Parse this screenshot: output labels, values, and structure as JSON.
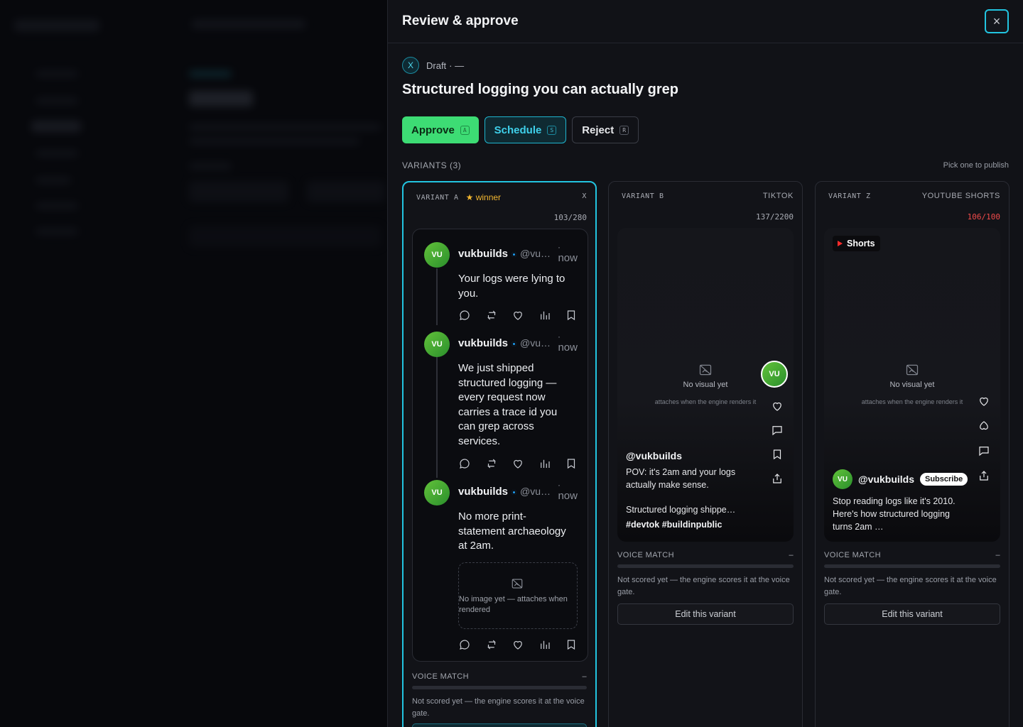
{
  "drawer": {
    "title": "Review & approve",
    "close_label": "×"
  },
  "post": {
    "platform_badge": "X",
    "status": "Draft",
    "status_suffix": "· —",
    "title": "Structured logging you can actually grep"
  },
  "actions": {
    "approve": {
      "label": "Approve",
      "key": "A"
    },
    "schedule": {
      "label": "Schedule",
      "key": "S"
    },
    "reject": {
      "label": "Reject",
      "key": "R"
    }
  },
  "variants_section": {
    "label": "VARIANTS (3)",
    "hint": "Pick one to publish"
  },
  "variants": [
    {
      "label": "VARIANT A",
      "winner_label": "winner",
      "platform": "X",
      "counter": "103/280",
      "thread": [
        {
          "avatar": "VU",
          "name": "vukbuilds",
          "handle": "@vu…",
          "dot": "·",
          "time": "now",
          "text": "Your logs were lying to you."
        },
        {
          "avatar": "VU",
          "name": "vukbuilds",
          "handle": "@vu…",
          "dot": "·",
          "time": "now",
          "text": "We just shipped structured logging — every request now carries a trace id you can grep across services."
        },
        {
          "avatar": "VU",
          "name": "vukbuilds",
          "handle": "@vu…",
          "dot": "·",
          "time": "now",
          "text": "No more print-statement archaeology at 2am.",
          "image_placeholder": "No image yet — attaches when rendered"
        }
      ],
      "voice_label": "VOICE MATCH",
      "voice_value": "–",
      "voice_score": 0,
      "voice_note": "Not scored yet — the engine scores it at the voice gate."
    },
    {
      "label": "VARIANT B",
      "platform": "TIKTOK",
      "counter": "137/2200",
      "no_visual_title": "No visual yet",
      "no_visual_sub": "attaches when the engine renders it",
      "avatar": "VU",
      "handle": "@vukbuilds",
      "caption": "POV: it's 2am and your logs actually make sense.",
      "caption2": "Structured logging shippe…",
      "tags": "#devtok #buildinpublic",
      "voice_label": "VOICE MATCH",
      "voice_value": "–",
      "voice_score": 0,
      "voice_note": "Not scored yet — the engine scores it at the voice gate.",
      "edit_label": "Edit this variant"
    },
    {
      "label": "VARIANT Z",
      "platform": "YOUTUBE SHORTS",
      "counter": "106/100",
      "shorts_label": "Shorts",
      "no_visual_title": "No visual yet",
      "no_visual_sub": "attaches when the engine renders it",
      "avatar": "VU",
      "handle": "@vukbuilds",
      "subscribe_label": "Subscribe",
      "caption": "Stop reading logs like it's 2010. Here's how structured logging turns 2am …",
      "voice_label": "VOICE MATCH",
      "voice_value": "–",
      "voice_score": 0,
      "voice_note": "Not scored yet — the engine scores it at the voice gate.",
      "edit_label": "Edit this variant"
    }
  ],
  "colors": {
    "accent": "#22c4e0",
    "approve": "#3ddc74",
    "winner": "#f2b630",
    "over_limit": "#f04a4a"
  }
}
